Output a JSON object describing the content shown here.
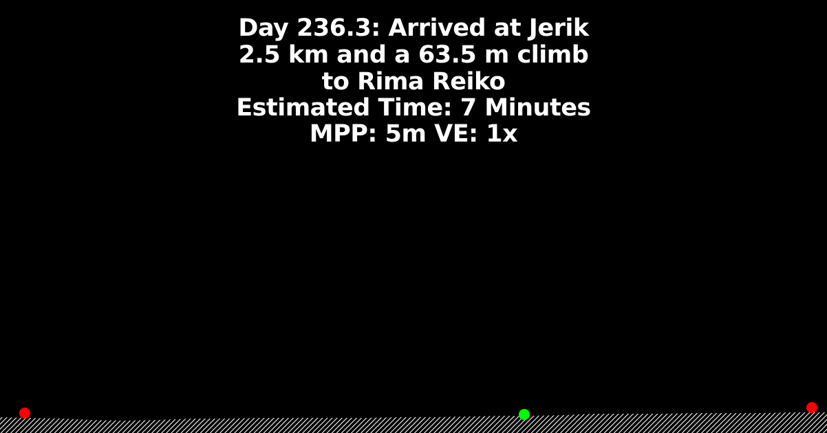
{
  "header": {
    "title": "Day 236.3: Arrived at Jerik",
    "distance_line": "2.5 km and a 63.5 m climb",
    "destination_line": "to Rima Reiko",
    "estimate_line": "Estimated Time: 7 Minutes",
    "scale_line": "MPP: 5m VE: 1x"
  },
  "markers": {
    "start_color": "#ff0000",
    "current_color": "#00ff00",
    "end_color": "#ff0000"
  },
  "colors": {
    "background": "#000000",
    "text": "#ffffff",
    "terrain": "#ffffff"
  }
}
